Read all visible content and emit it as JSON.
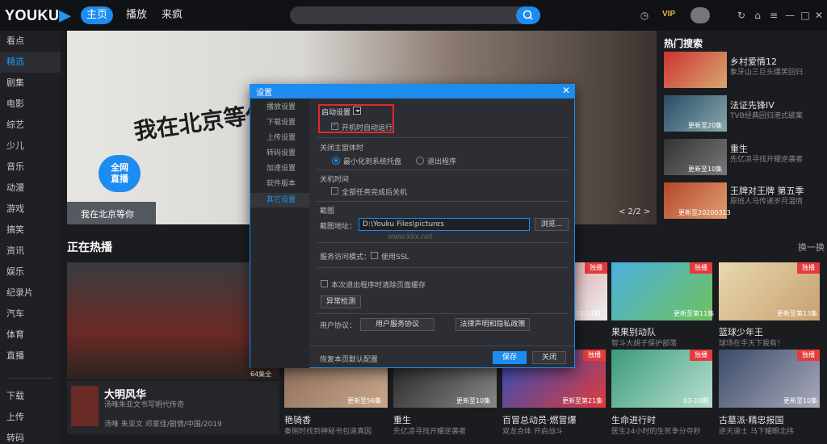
{
  "app": {
    "logo_text": "YOUKU"
  },
  "nav": [
    {
      "label": "主页"
    },
    {
      "label": "播放"
    },
    {
      "label": "来疯"
    }
  ],
  "vip_label": "VIP",
  "sidebar": [
    {
      "label": "看点"
    },
    {
      "label": "精选"
    },
    {
      "label": "剧集"
    },
    {
      "label": "电影"
    },
    {
      "label": "综艺"
    },
    {
      "label": "少儿"
    },
    {
      "label": "音乐"
    },
    {
      "label": "动漫"
    },
    {
      "label": "游戏"
    },
    {
      "label": "搞笑"
    },
    {
      "label": "资讯"
    },
    {
      "label": "娱乐"
    },
    {
      "label": "纪录片"
    },
    {
      "label": "汽车"
    },
    {
      "label": "体育"
    },
    {
      "label": "直播"
    },
    {
      "label": "下载"
    },
    {
      "label": "上传"
    },
    {
      "label": "转码"
    }
  ],
  "banner": {
    "title": "我在北京等你",
    "big_text": "我在北京等你",
    "badge_line1": "全网",
    "badge_line2": "直播",
    "page": "< 2/2 >"
  },
  "hot_search": {
    "title": "热门搜索",
    "items": [
      {
        "name": "乡村爱情12",
        "desc": "象牙山三巨头爆笑回归",
        "ep": ""
      },
      {
        "name": "法证先锋IV",
        "desc": "TVB经典回归港式破案",
        "ep": "更新至20集"
      },
      {
        "name": "重生",
        "desc": "先亿凉寻找开耀逆袭者",
        "ep": "更新至10集"
      },
      {
        "name": "王牌对王牌 第五季",
        "desc": "原班人马传递岁月温情",
        "ep": "更新至20200313"
      }
    ]
  },
  "hot_section": {
    "title": "正在热播",
    "refresh": "换一换",
    "feature": {
      "name": "大明风华",
      "desc": "汤唯朱亚文书写明代传奇",
      "cast": "汤唯 朱亚文 邓家佳/剧情/中国/2019",
      "ep": "64集全"
    },
    "cards": [
      {
        "title": "",
        "desc": "",
        "ep": "03-14期",
        "badge": "独播"
      },
      {
        "title": "果果别动队",
        "desc": "智斗大胡子保护部落",
        "ep": "更新至第11集",
        "badge": "独播"
      },
      {
        "title": "篮球少年王",
        "desc": "球场在手天下我有！",
        "ep": "更新至第13集",
        "badge": "独播"
      },
      {
        "title": "艳骑香",
        "desc": "秦俐时找到神秘书包道真因",
        "ep": "更新至56集",
        "badge": ""
      },
      {
        "title": "重生",
        "desc": "先亿凉寻找开耀逆袭者",
        "ep": "更新至10集",
        "badge": ""
      },
      {
        "title": "百冒总动员·燃冒爆",
        "desc": "双龙合体 开启战斗",
        "ep": "更新至第21集",
        "badge": "独播"
      },
      {
        "title": "生命进行时",
        "desc": "医生24小时的生死争分夺秒",
        "ep": "03-10期",
        "badge": "独播"
      },
      {
        "title": "古墓派·精忠报国",
        "desc": "逆天道士 马下耀眼北纬",
        "ep": "更新至10集",
        "badge": "独播"
      }
    ]
  },
  "dialog": {
    "title": "设置",
    "close": "✕",
    "nav": [
      {
        "label": "播放设置"
      },
      {
        "label": "下载设置"
      },
      {
        "label": "上传设置"
      },
      {
        "label": "转码设置"
      },
      {
        "label": "加速设置"
      },
      {
        "label": "软件版本"
      },
      {
        "label": "其它设置"
      }
    ],
    "startup_label": "启动设置",
    "startup_check": "开机时自动运行",
    "close_main_label": "关闭主窗体时",
    "radio_minimize": "最小化到系统托盘",
    "radio_exit": "退出程序",
    "shutdown_label": "关机时间",
    "shutdown_check": "全部任务完成后关机",
    "screenshot_label": "截图",
    "screenshot_path_label": "截图地址：",
    "screenshot_path": "D:\\Youku Files\\pictures",
    "browse": "浏览...",
    "service_label": "服务访问模式：",
    "ssl_check": "使用SSL",
    "clear_cache_check": "本次退出程序时清除页面缓存",
    "detect_btn": "异常检测",
    "agreement_label": "用户协议：",
    "agreement_btn": "用户服务协议",
    "privacy_btn": "法律声明和隐私政策",
    "restore_default": "恢复本页默认配置",
    "save": "保存",
    "close_btn": "关闭"
  },
  "watermark": "www.kkx.net",
  "colors": {
    "accent": "#1c8cf0",
    "highlight_box": "#e02a2a",
    "badge": "#e63b3b"
  }
}
